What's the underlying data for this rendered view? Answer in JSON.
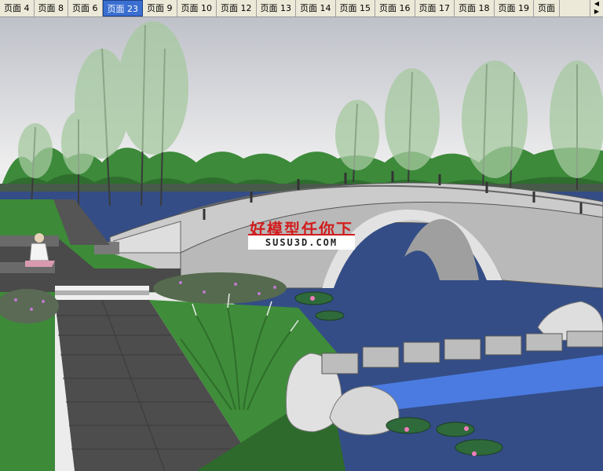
{
  "scene_tabs": [
    {
      "label": "页面 4"
    },
    {
      "label": "页面 8"
    },
    {
      "label": "页面 6"
    },
    {
      "label": "页面 23",
      "active": true
    },
    {
      "label": "页面 9"
    },
    {
      "label": "页面 10"
    },
    {
      "label": "页面 12"
    },
    {
      "label": "页面 13"
    },
    {
      "label": "页面 14"
    },
    {
      "label": "页面 15"
    },
    {
      "label": "页面 16"
    },
    {
      "label": "页面 17"
    },
    {
      "label": "页面 18"
    },
    {
      "label": "页面 19"
    },
    {
      "label": "页面"
    }
  ],
  "active_tab_color": "#3a6fd1",
  "watermark": {
    "cn": "好模型任你下",
    "en": "SUSU3D.COM",
    "color": "#d21d1d"
  },
  "colors": {
    "sky_top": "#c4c6cc",
    "sky_bottom": "#eeeeee",
    "water": "#344d86",
    "lawn": "#3d8a38",
    "path": "#555555",
    "bridge": "#c9c9c9"
  }
}
